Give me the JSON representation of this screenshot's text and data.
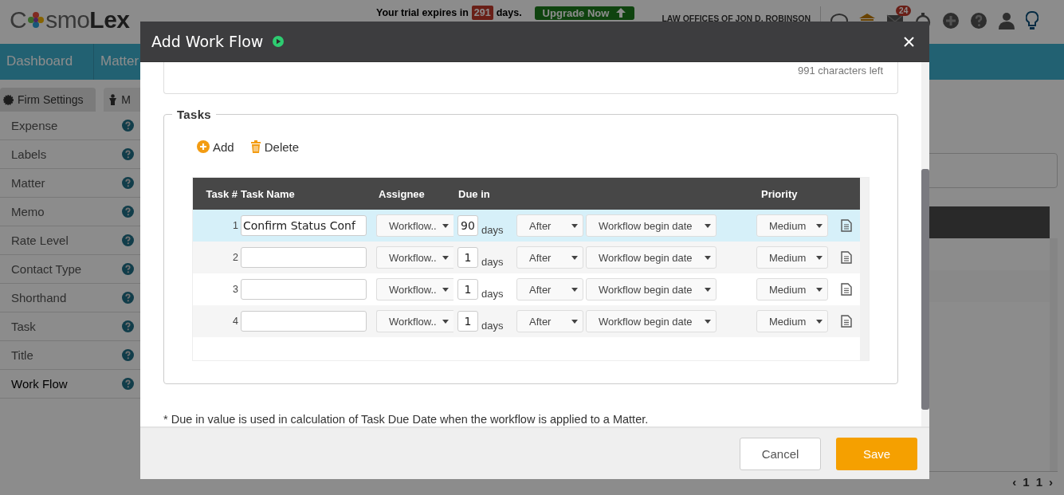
{
  "app_header": {
    "logo": [
      "C",
      "smo**Lex**"
    ],
    "trial_text": "Your trial expires in",
    "trial_days": "291",
    "trial_suffix": "days.",
    "upgrade_button": "Upgrade Now",
    "firm_name": "LAW OFFICES OF JON D. ROBINSON",
    "mail_badge": "24"
  },
  "nav": {
    "items": [
      "Dashboard",
      "Matter"
    ]
  },
  "settings_tabs": [
    {
      "label": "Firm Settings",
      "selected": true
    },
    {
      "label": "M",
      "selected": false
    }
  ],
  "sidebar": {
    "items": [
      {
        "label": "Expense",
        "selected": false
      },
      {
        "label": "Labels",
        "selected": false
      },
      {
        "label": "Matter",
        "selected": false
      },
      {
        "label": "Memo",
        "selected": false
      },
      {
        "label": "Rate Level",
        "selected": false
      },
      {
        "label": "Contact Type",
        "selected": false
      },
      {
        "label": "Shorthand",
        "selected": false
      },
      {
        "label": "Task",
        "selected": false
      },
      {
        "label": "Title",
        "selected": false
      },
      {
        "label": "Work Flow",
        "selected": true
      }
    ]
  },
  "pagination": [
    "‹",
    "1",
    "1",
    "›"
  ],
  "dialog": {
    "title": "Add Work Flow",
    "chars_left": "991 characters left",
    "tasks_legend": "Tasks",
    "toolbar": [
      {
        "kind": "add",
        "label": "Add"
      },
      {
        "kind": "delete",
        "label": "Delete"
      }
    ],
    "table": {
      "columns": [
        "Task #",
        "Task Name",
        "Assignee",
        "Due in",
        "Priority"
      ],
      "rows": [
        {
          "task_number": "1",
          "task_name": "Confirm Status Conf",
          "assignee": "Workflow..",
          "due_in": "90",
          "unit": "days",
          "relation": "After",
          "base": "Workflow begin date",
          "priority": "Medium",
          "selected": true
        },
        {
          "task_number": "2",
          "task_name": "",
          "assignee": "Workflow..",
          "due_in": "1",
          "unit": "days",
          "relation": "After",
          "base": "Workflow begin date",
          "priority": "Medium",
          "selected": false
        },
        {
          "task_number": "3",
          "task_name": "",
          "assignee": "Workflow..",
          "due_in": "1",
          "unit": "days",
          "relation": "After",
          "base": "Workflow begin date",
          "priority": "Medium",
          "selected": false
        },
        {
          "task_number": "4",
          "task_name": "",
          "assignee": "Workflow..",
          "due_in": "1",
          "unit": "days",
          "relation": "After",
          "base": "Workflow begin date",
          "priority": "Medium",
          "selected": false
        }
      ]
    },
    "note": "* Due in value is used in calculation of Task Due Date when the workflow is applied to a Matter.",
    "buttons": [
      {
        "kind": "secondary",
        "label": "Cancel"
      },
      {
        "kind": "primary",
        "label": "Save"
      }
    ]
  }
}
